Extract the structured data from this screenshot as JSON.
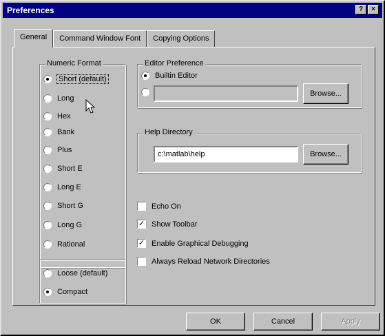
{
  "window": {
    "title": "Preferences",
    "help_button": "?",
    "close_button": "×"
  },
  "tabs": [
    {
      "label": "General"
    },
    {
      "label": "Command Window Font"
    },
    {
      "label": "Copying Options"
    }
  ],
  "numeric_format": {
    "label": "Numeric Format",
    "options": [
      {
        "label": "Short (default)"
      },
      {
        "label": "Long"
      },
      {
        "label": "Hex"
      },
      {
        "label": "Bank"
      },
      {
        "label": "Plus"
      },
      {
        "label": "Short E"
      },
      {
        "label": "Long E"
      },
      {
        "label": "Short G"
      },
      {
        "label": "Long G"
      },
      {
        "label": "Rational"
      }
    ],
    "selected": "Short (default)"
  },
  "spacing": {
    "options": [
      {
        "label": "Loose (default)"
      },
      {
        "label": "Compact"
      }
    ],
    "selected": "Compact"
  },
  "editor_preference": {
    "label": "Editor Preference",
    "builtin_label": "Builtin Editor",
    "custom_value": "",
    "browse_label": "Browse..."
  },
  "help_directory": {
    "label": "Help Directory",
    "value": "c:\\matlab\\help",
    "browse_label": "Browse..."
  },
  "checkboxes": [
    {
      "label": "Echo On",
      "checked": false
    },
    {
      "label": "Show Toolbar",
      "checked": true
    },
    {
      "label": "Enable Graphical Debugging",
      "checked": true
    },
    {
      "label": "Always Reload Network Directories",
      "checked": false
    }
  ],
  "footer": {
    "ok_label": "OK",
    "cancel_label": "Cancel",
    "apply_label": "Apply"
  }
}
